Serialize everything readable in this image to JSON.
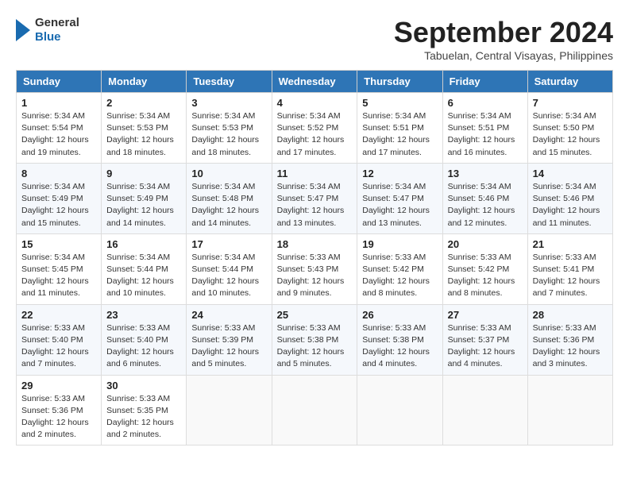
{
  "header": {
    "logo_general": "General",
    "logo_blue": "Blue",
    "month_title": "September 2024",
    "location": "Tabuelan, Central Visayas, Philippines"
  },
  "weekdays": [
    "Sunday",
    "Monday",
    "Tuesday",
    "Wednesday",
    "Thursday",
    "Friday",
    "Saturday"
  ],
  "weeks": [
    [
      {
        "day": "1",
        "sunrise": "5:34 AM",
        "sunset": "5:54 PM",
        "daylight": "12 hours and 19 minutes."
      },
      {
        "day": "2",
        "sunrise": "5:34 AM",
        "sunset": "5:53 PM",
        "daylight": "12 hours and 18 minutes."
      },
      {
        "day": "3",
        "sunrise": "5:34 AM",
        "sunset": "5:53 PM",
        "daylight": "12 hours and 18 minutes."
      },
      {
        "day": "4",
        "sunrise": "5:34 AM",
        "sunset": "5:52 PM",
        "daylight": "12 hours and 17 minutes."
      },
      {
        "day": "5",
        "sunrise": "5:34 AM",
        "sunset": "5:51 PM",
        "daylight": "12 hours and 17 minutes."
      },
      {
        "day": "6",
        "sunrise": "5:34 AM",
        "sunset": "5:51 PM",
        "daylight": "12 hours and 16 minutes."
      },
      {
        "day": "7",
        "sunrise": "5:34 AM",
        "sunset": "5:50 PM",
        "daylight": "12 hours and 15 minutes."
      }
    ],
    [
      {
        "day": "8",
        "sunrise": "5:34 AM",
        "sunset": "5:49 PM",
        "daylight": "12 hours and 15 minutes."
      },
      {
        "day": "9",
        "sunrise": "5:34 AM",
        "sunset": "5:49 PM",
        "daylight": "12 hours and 14 minutes."
      },
      {
        "day": "10",
        "sunrise": "5:34 AM",
        "sunset": "5:48 PM",
        "daylight": "12 hours and 14 minutes."
      },
      {
        "day": "11",
        "sunrise": "5:34 AM",
        "sunset": "5:47 PM",
        "daylight": "12 hours and 13 minutes."
      },
      {
        "day": "12",
        "sunrise": "5:34 AM",
        "sunset": "5:47 PM",
        "daylight": "12 hours and 13 minutes."
      },
      {
        "day": "13",
        "sunrise": "5:34 AM",
        "sunset": "5:46 PM",
        "daylight": "12 hours and 12 minutes."
      },
      {
        "day": "14",
        "sunrise": "5:34 AM",
        "sunset": "5:46 PM",
        "daylight": "12 hours and 11 minutes."
      }
    ],
    [
      {
        "day": "15",
        "sunrise": "5:34 AM",
        "sunset": "5:45 PM",
        "daylight": "12 hours and 11 minutes."
      },
      {
        "day": "16",
        "sunrise": "5:34 AM",
        "sunset": "5:44 PM",
        "daylight": "12 hours and 10 minutes."
      },
      {
        "day": "17",
        "sunrise": "5:34 AM",
        "sunset": "5:44 PM",
        "daylight": "12 hours and 10 minutes."
      },
      {
        "day": "18",
        "sunrise": "5:33 AM",
        "sunset": "5:43 PM",
        "daylight": "12 hours and 9 minutes."
      },
      {
        "day": "19",
        "sunrise": "5:33 AM",
        "sunset": "5:42 PM",
        "daylight": "12 hours and 8 minutes."
      },
      {
        "day": "20",
        "sunrise": "5:33 AM",
        "sunset": "5:42 PM",
        "daylight": "12 hours and 8 minutes."
      },
      {
        "day": "21",
        "sunrise": "5:33 AM",
        "sunset": "5:41 PM",
        "daylight": "12 hours and 7 minutes."
      }
    ],
    [
      {
        "day": "22",
        "sunrise": "5:33 AM",
        "sunset": "5:40 PM",
        "daylight": "12 hours and 7 minutes."
      },
      {
        "day": "23",
        "sunrise": "5:33 AM",
        "sunset": "5:40 PM",
        "daylight": "12 hours and 6 minutes."
      },
      {
        "day": "24",
        "sunrise": "5:33 AM",
        "sunset": "5:39 PM",
        "daylight": "12 hours and 5 minutes."
      },
      {
        "day": "25",
        "sunrise": "5:33 AM",
        "sunset": "5:38 PM",
        "daylight": "12 hours and 5 minutes."
      },
      {
        "day": "26",
        "sunrise": "5:33 AM",
        "sunset": "5:38 PM",
        "daylight": "12 hours and 4 minutes."
      },
      {
        "day": "27",
        "sunrise": "5:33 AM",
        "sunset": "5:37 PM",
        "daylight": "12 hours and 4 minutes."
      },
      {
        "day": "28",
        "sunrise": "5:33 AM",
        "sunset": "5:36 PM",
        "daylight": "12 hours and 3 minutes."
      }
    ],
    [
      {
        "day": "29",
        "sunrise": "5:33 AM",
        "sunset": "5:36 PM",
        "daylight": "12 hours and 2 minutes."
      },
      {
        "day": "30",
        "sunrise": "5:33 AM",
        "sunset": "5:35 PM",
        "daylight": "12 hours and 2 minutes."
      },
      null,
      null,
      null,
      null,
      null
    ]
  ]
}
